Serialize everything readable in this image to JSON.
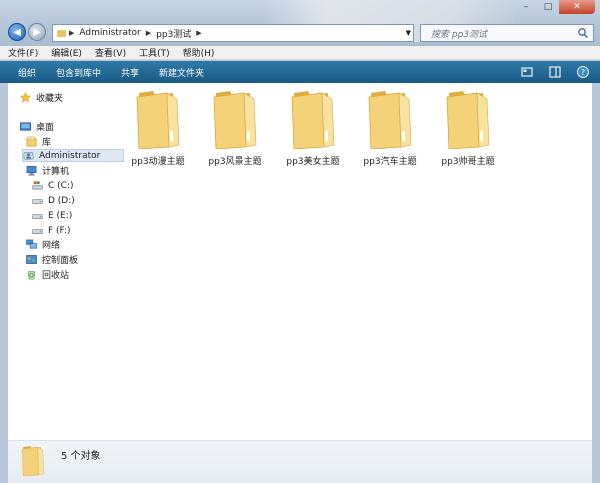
{
  "window": {
    "search_placeholder": "搜索 pp3测试",
    "controls": [
      "–",
      "□",
      "✕"
    ]
  },
  "address": {
    "segments": [
      "Administrator",
      "pp3测试"
    ]
  },
  "menu": [
    "文件(F)",
    "编辑(E)",
    "查看(V)",
    "工具(T)",
    "帮助(H)"
  ],
  "commands": [
    "组织",
    "包含到库中",
    "共享",
    "新建文件夹"
  ],
  "sidebar": {
    "favorites": "收藏夹",
    "items": [
      {
        "label": "桌面",
        "icon": "desktop-icon"
      },
      {
        "label": "库",
        "icon": "library-icon"
      },
      {
        "label": "Administrator",
        "icon": "user-icon",
        "selected": true
      },
      {
        "label": "计算机",
        "icon": "computer-icon"
      },
      {
        "label": "C (C:)",
        "icon": "drive-c-icon"
      },
      {
        "label": "D (D:)",
        "icon": "drive-icon"
      },
      {
        "label": "E (E:)",
        "icon": "drive-icon"
      },
      {
        "label": "F (F:)",
        "icon": "drive-icon"
      },
      {
        "label": "网络",
        "icon": "network-icon"
      },
      {
        "label": "控制面板",
        "icon": "control-panel-icon"
      },
      {
        "label": "回收站",
        "icon": "recycle-bin-icon"
      }
    ]
  },
  "folders": [
    "pp3动漫主题",
    "pp3风景主题",
    "pp3美女主题",
    "pp3汽车主题",
    "pp3帅哥主题"
  ],
  "details": {
    "count": "5 个对象"
  },
  "colors": {
    "command_bar": "#1f6590",
    "folder": "#f0cf73",
    "selection": "#dde8f3"
  }
}
